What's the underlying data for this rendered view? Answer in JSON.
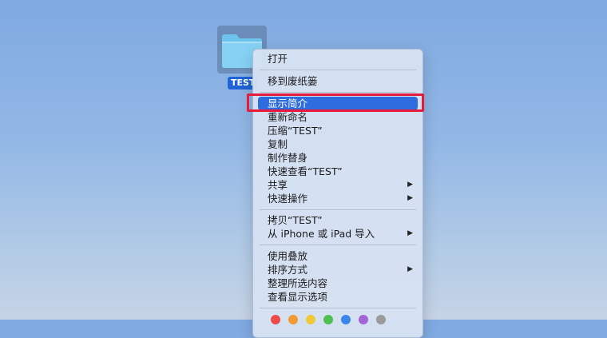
{
  "desktop": {
    "folder": {
      "label": "TEST"
    }
  },
  "context_menu": {
    "groups": [
      {
        "items": [
          {
            "label": "打开"
          }
        ]
      },
      {
        "items": [
          {
            "label": "移到废纸篓"
          }
        ]
      },
      {
        "items": [
          {
            "label": "显示简介",
            "selected": true
          },
          {
            "label": "重新命名"
          },
          {
            "label": "压缩“TEST”"
          },
          {
            "label": "复制"
          },
          {
            "label": "制作替身"
          },
          {
            "label": "快速查看“TEST”"
          },
          {
            "label": "共享",
            "submenu": true
          },
          {
            "label": "快速操作",
            "submenu": true
          }
        ]
      },
      {
        "items": [
          {
            "label": "拷贝“TEST”"
          },
          {
            "label": "从 iPhone 或 iPad 导入",
            "submenu": true
          }
        ]
      },
      {
        "items": [
          {
            "label": "使用叠放"
          },
          {
            "label": "排序方式",
            "submenu": true
          },
          {
            "label": "整理所选内容"
          },
          {
            "label": "查看显示选项"
          }
        ]
      }
    ],
    "tag_colors": [
      "#ee4a4a",
      "#f39a33",
      "#f1c83a",
      "#4fbf4f",
      "#3b86e8",
      "#a463d6",
      "#9a9a9a"
    ],
    "submenu_arrow": "▶"
  },
  "annotation": {
    "color": "#e61b3c"
  }
}
